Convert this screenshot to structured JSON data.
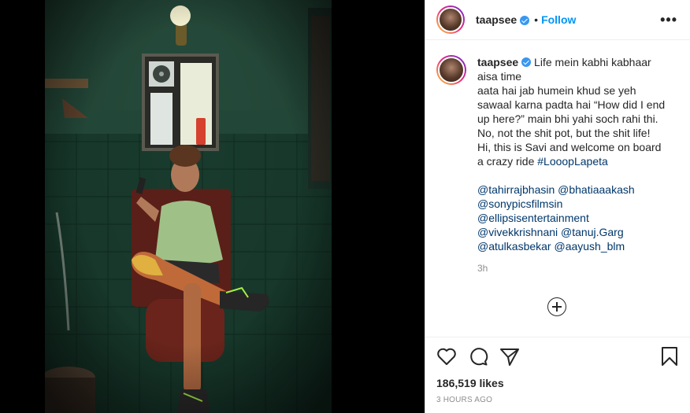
{
  "post": {
    "username": "taapsee",
    "follow_label": "Follow",
    "more_label": "•••",
    "caption_lines": [
      "Life mein kabhi kabhaar",
      "aisa time",
      "aata hai jab humein khud se yeh",
      "sawaal karna padta hai “How did I end",
      "up here?” main bhi yahi soch rahi thi.",
      "No, not the shit pot, but the shit life!",
      "Hi, this is Savi and welcome on board",
      "a crazy ride"
    ],
    "hashtag": "#LooopLapeta",
    "mentions": [
      "@tahirrajbhasin @bhatiaaakash",
      "@sonypicsfilmsin",
      "@ellipsisentertainment",
      "@vivekkrishnani @tanuj.Garg",
      "@atulkasbekar @aayush_blm"
    ],
    "caption_time": "3h",
    "likes": "186,519 likes",
    "posted_ago": "3 HOURS AGO"
  },
  "icons": {
    "verified": "verified-badge-icon",
    "more": "more-options-icon",
    "load_more": "plus-circle-icon",
    "like": "heart-icon",
    "comment": "comment-icon",
    "share": "share-icon",
    "save": "bookmark-icon"
  },
  "colors": {
    "follow": "#0095f6",
    "verified": "#3897f0",
    "mention": "#00376b"
  }
}
